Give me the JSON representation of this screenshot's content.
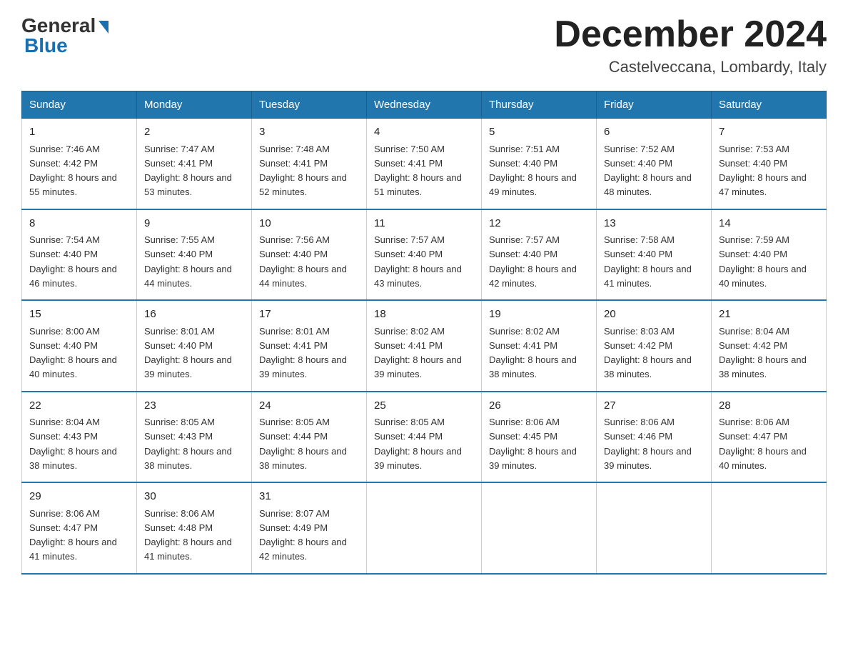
{
  "logo": {
    "general": "General",
    "blue": "Blue"
  },
  "title": "December 2024",
  "location": "Castelveccana, Lombardy, Italy",
  "days_of_week": [
    "Sunday",
    "Monday",
    "Tuesday",
    "Wednesday",
    "Thursday",
    "Friday",
    "Saturday"
  ],
  "weeks": [
    [
      {
        "day": "1",
        "sunrise": "7:46 AM",
        "sunset": "4:42 PM",
        "daylight": "8 hours and 55 minutes."
      },
      {
        "day": "2",
        "sunrise": "7:47 AM",
        "sunset": "4:41 PM",
        "daylight": "8 hours and 53 minutes."
      },
      {
        "day": "3",
        "sunrise": "7:48 AM",
        "sunset": "4:41 PM",
        "daylight": "8 hours and 52 minutes."
      },
      {
        "day": "4",
        "sunrise": "7:50 AM",
        "sunset": "4:41 PM",
        "daylight": "8 hours and 51 minutes."
      },
      {
        "day": "5",
        "sunrise": "7:51 AM",
        "sunset": "4:40 PM",
        "daylight": "8 hours and 49 minutes."
      },
      {
        "day": "6",
        "sunrise": "7:52 AM",
        "sunset": "4:40 PM",
        "daylight": "8 hours and 48 minutes."
      },
      {
        "day": "7",
        "sunrise": "7:53 AM",
        "sunset": "4:40 PM",
        "daylight": "8 hours and 47 minutes."
      }
    ],
    [
      {
        "day": "8",
        "sunrise": "7:54 AM",
        "sunset": "4:40 PM",
        "daylight": "8 hours and 46 minutes."
      },
      {
        "day": "9",
        "sunrise": "7:55 AM",
        "sunset": "4:40 PM",
        "daylight": "8 hours and 44 minutes."
      },
      {
        "day": "10",
        "sunrise": "7:56 AM",
        "sunset": "4:40 PM",
        "daylight": "8 hours and 44 minutes."
      },
      {
        "day": "11",
        "sunrise": "7:57 AM",
        "sunset": "4:40 PM",
        "daylight": "8 hours and 43 minutes."
      },
      {
        "day": "12",
        "sunrise": "7:57 AM",
        "sunset": "4:40 PM",
        "daylight": "8 hours and 42 minutes."
      },
      {
        "day": "13",
        "sunrise": "7:58 AM",
        "sunset": "4:40 PM",
        "daylight": "8 hours and 41 minutes."
      },
      {
        "day": "14",
        "sunrise": "7:59 AM",
        "sunset": "4:40 PM",
        "daylight": "8 hours and 40 minutes."
      }
    ],
    [
      {
        "day": "15",
        "sunrise": "8:00 AM",
        "sunset": "4:40 PM",
        "daylight": "8 hours and 40 minutes."
      },
      {
        "day": "16",
        "sunrise": "8:01 AM",
        "sunset": "4:40 PM",
        "daylight": "8 hours and 39 minutes."
      },
      {
        "day": "17",
        "sunrise": "8:01 AM",
        "sunset": "4:41 PM",
        "daylight": "8 hours and 39 minutes."
      },
      {
        "day": "18",
        "sunrise": "8:02 AM",
        "sunset": "4:41 PM",
        "daylight": "8 hours and 39 minutes."
      },
      {
        "day": "19",
        "sunrise": "8:02 AM",
        "sunset": "4:41 PM",
        "daylight": "8 hours and 38 minutes."
      },
      {
        "day": "20",
        "sunrise": "8:03 AM",
        "sunset": "4:42 PM",
        "daylight": "8 hours and 38 minutes."
      },
      {
        "day": "21",
        "sunrise": "8:04 AM",
        "sunset": "4:42 PM",
        "daylight": "8 hours and 38 minutes."
      }
    ],
    [
      {
        "day": "22",
        "sunrise": "8:04 AM",
        "sunset": "4:43 PM",
        "daylight": "8 hours and 38 minutes."
      },
      {
        "day": "23",
        "sunrise": "8:05 AM",
        "sunset": "4:43 PM",
        "daylight": "8 hours and 38 minutes."
      },
      {
        "day": "24",
        "sunrise": "8:05 AM",
        "sunset": "4:44 PM",
        "daylight": "8 hours and 38 minutes."
      },
      {
        "day": "25",
        "sunrise": "8:05 AM",
        "sunset": "4:44 PM",
        "daylight": "8 hours and 39 minutes."
      },
      {
        "day": "26",
        "sunrise": "8:06 AM",
        "sunset": "4:45 PM",
        "daylight": "8 hours and 39 minutes."
      },
      {
        "day": "27",
        "sunrise": "8:06 AM",
        "sunset": "4:46 PM",
        "daylight": "8 hours and 39 minutes."
      },
      {
        "day": "28",
        "sunrise": "8:06 AM",
        "sunset": "4:47 PM",
        "daylight": "8 hours and 40 minutes."
      }
    ],
    [
      {
        "day": "29",
        "sunrise": "8:06 AM",
        "sunset": "4:47 PM",
        "daylight": "8 hours and 41 minutes."
      },
      {
        "day": "30",
        "sunrise": "8:06 AM",
        "sunset": "4:48 PM",
        "daylight": "8 hours and 41 minutes."
      },
      {
        "day": "31",
        "sunrise": "8:07 AM",
        "sunset": "4:49 PM",
        "daylight": "8 hours and 42 minutes."
      },
      null,
      null,
      null,
      null
    ]
  ]
}
